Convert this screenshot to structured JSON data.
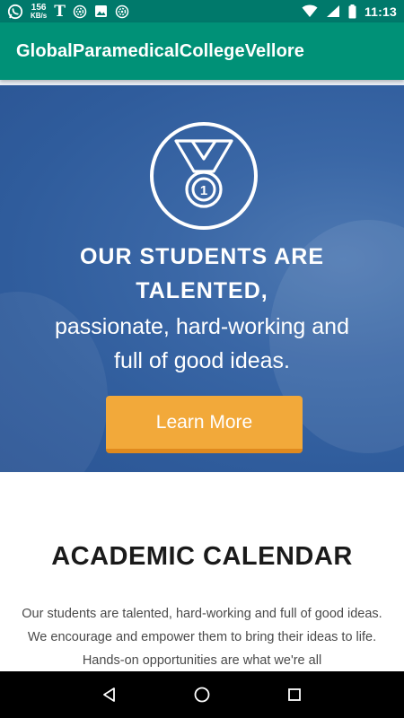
{
  "status_bar": {
    "netspeed_value": "156",
    "netspeed_unit": "KB/s",
    "t_glyph": "T",
    "time": "11:13"
  },
  "app_bar": {
    "title": "GlobalParamedicalCollegeVellore"
  },
  "hero": {
    "medal_number": "1",
    "heading_line1": "OUR STUDENTS ARE",
    "heading_line2": "TALENTED,",
    "subtext_line1": "passionate, hard-working and",
    "subtext_line2": "full of good ideas.",
    "button_label": "Learn More",
    "colors": {
      "background": "#2f5c9c",
      "button": "#f2a93a"
    }
  },
  "academic": {
    "title": "ACADEMIC CALENDAR",
    "body": "Our students are talented, hard-working and full of good ideas. We encourage and empower them to bring their ideas to life. Hands-on opportunities are what we're all"
  },
  "colors": {
    "status_bar": "#00796b",
    "app_bar": "#009177"
  }
}
